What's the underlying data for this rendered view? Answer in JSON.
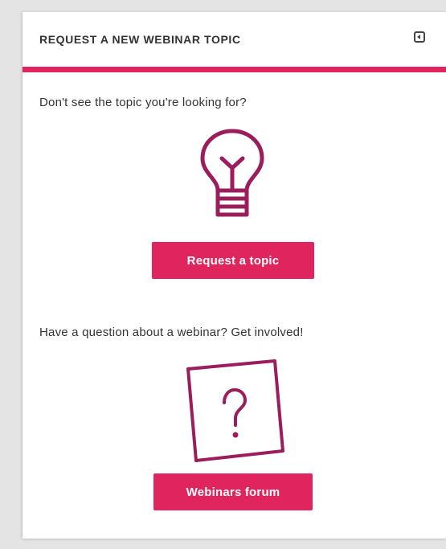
{
  "panel": {
    "title": "REQUEST A NEW WEBINAR TOPIC",
    "collapse_icon": "collapse-left-icon"
  },
  "request_section": {
    "prompt": "Don't see the topic you're looking for?",
    "icon": "lightbulb-icon",
    "button_label": "Request a topic"
  },
  "forum_section": {
    "prompt": "Have a question about a webinar? Get involved!",
    "icon": "question-mark-icon",
    "button_label": "Webinars forum"
  },
  "colors": {
    "accent": "#e0245e",
    "icon_stroke": "#9b1d5b",
    "text": "#333333"
  }
}
